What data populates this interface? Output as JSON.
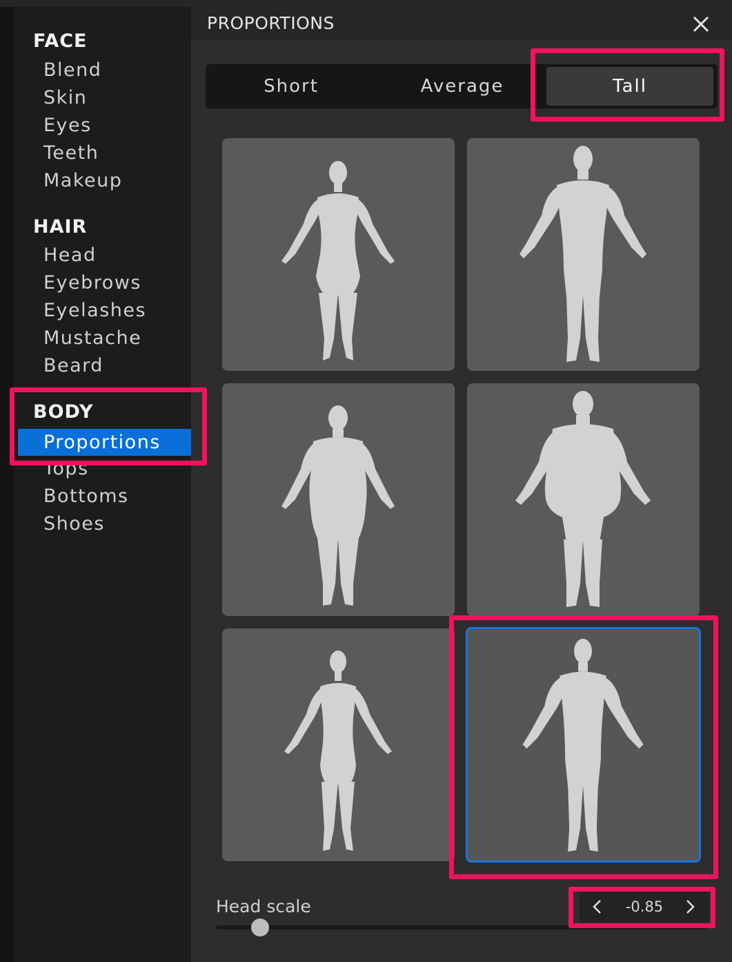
{
  "panel": {
    "title": "PROPORTIONS"
  },
  "sidebar": {
    "sections": [
      {
        "title": "FACE",
        "items": [
          "Blend",
          "Skin",
          "Eyes",
          "Teeth",
          "Makeup"
        ]
      },
      {
        "title": "HAIR",
        "items": [
          "Head",
          "Eyebrows",
          "Eyelashes",
          "Mustache",
          "Beard"
        ]
      },
      {
        "title": "BODY",
        "items": [
          "Proportions",
          "Tops",
          "Bottoms",
          "Shoes"
        ]
      }
    ],
    "active_item": "Proportions"
  },
  "height_tabs": {
    "options": [
      "Short",
      "Average",
      "Tall"
    ],
    "selected": "Tall"
  },
  "body_presets": {
    "tiles": [
      {
        "figure": "female-slim"
      },
      {
        "figure": "male-slim"
      },
      {
        "figure": "female-heavy"
      },
      {
        "figure": "male-heavy"
      },
      {
        "figure": "female-thin"
      },
      {
        "figure": "male-thin"
      }
    ],
    "selected_index": 5
  },
  "head_scale": {
    "label": "Head scale",
    "value": "-0.85"
  },
  "colors": {
    "accent": "#0a6fd8",
    "highlight": "#f0145a",
    "tile": "#5a5a5a",
    "figure": "#d2d2d2"
  },
  "icons": {
    "close": "close-icon",
    "prev": "chevron-left-icon",
    "next": "chevron-right-icon"
  }
}
